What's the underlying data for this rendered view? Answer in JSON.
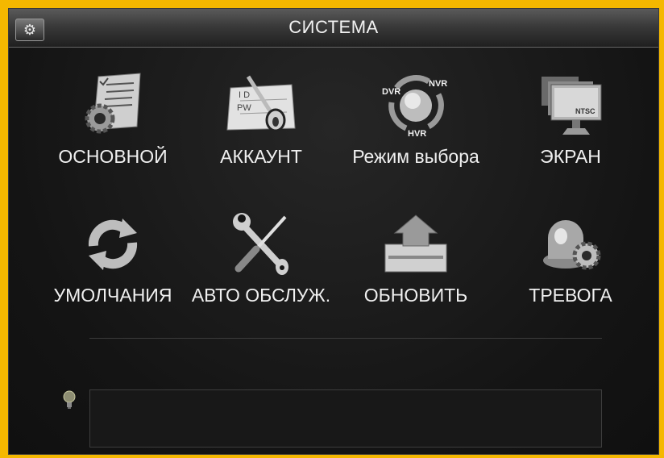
{
  "window": {
    "title": "СИСТЕМА",
    "title_icon": "gears-icon"
  },
  "menu": {
    "items": [
      {
        "id": "basic",
        "label": "ОСНОВНОЙ",
        "icon": "document-gear-icon"
      },
      {
        "id": "account",
        "label": "АККАУНТ",
        "icon": "account-key-icon"
      },
      {
        "id": "mode",
        "label": "Режим выбора",
        "icon": "dvr-nvr-hvr-mode-icon",
        "icon_texts": [
          "DVR",
          "NVR",
          "HVR"
        ]
      },
      {
        "id": "display",
        "label": "ЭКРАН",
        "icon": "monitor-icon",
        "icon_texts": [
          "NTSC"
        ]
      },
      {
        "id": "default",
        "label": "УМОЛЧАНИЯ",
        "icon": "refresh-icon"
      },
      {
        "id": "maintain",
        "label": "АВТО ОБСЛУЖ.",
        "icon": "wrench-screwdriver-icon"
      },
      {
        "id": "upgrade",
        "label": "ОБНОВИТЬ",
        "icon": "upgrade-tray-icon"
      },
      {
        "id": "alarm",
        "label": "ТРЕВОГА",
        "icon": "alarm-siren-gear-icon"
      }
    ]
  },
  "status": {
    "icon": "lightbulb-icon",
    "text": ""
  },
  "colors": {
    "frame": "#f5b800",
    "background": "#151515",
    "text": "#f0f0f0"
  }
}
